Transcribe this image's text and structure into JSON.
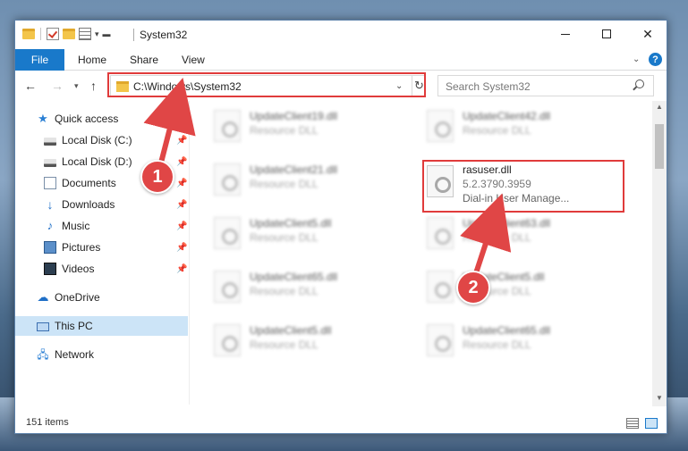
{
  "window": {
    "title": "System32",
    "ribbon_tabs": {
      "file": "File",
      "home": "Home",
      "share": "Share",
      "view": "View"
    },
    "help": "?"
  },
  "navigation": {
    "address": "C:\\Windows\\System32",
    "search_placeholder": "Search System32"
  },
  "sidebar": {
    "items": [
      {
        "label": "Quick access",
        "icon": "star-icon"
      },
      {
        "label": "Local Disk (C:)",
        "icon": "drive-icon",
        "pinned": true
      },
      {
        "label": "Local Disk (D:)",
        "icon": "drive-icon",
        "pinned": true
      },
      {
        "label": "Documents",
        "icon": "documents-icon",
        "pinned": true
      },
      {
        "label": "Downloads",
        "icon": "download-icon",
        "pinned": true
      },
      {
        "label": "Music",
        "icon": "music-icon",
        "pinned": true
      },
      {
        "label": "Pictures",
        "icon": "pictures-icon",
        "pinned": true
      },
      {
        "label": "Videos",
        "icon": "videos-icon",
        "pinned": true
      },
      {
        "label": "OneDrive",
        "icon": "onedrive-icon"
      },
      {
        "label": "This PC",
        "icon": "pc-icon",
        "selected": true
      },
      {
        "label": "Network",
        "icon": "network-icon"
      }
    ]
  },
  "files": [
    {
      "name": "UpdateClient19.dll",
      "type": "Resource DLL"
    },
    {
      "name": "UpdateClient42.dll",
      "type": "Resource DLL"
    },
    {
      "name": "UpdateClient21.dll",
      "type": "Resource DLL"
    },
    {
      "name": "rasuser.dll",
      "type": "5.2.3790.3959",
      "description": "Dial-in User Manage..."
    },
    {
      "name": "UpdateClient5.dll",
      "type": "Resource DLL"
    },
    {
      "name": "UpdateClient63.dll",
      "type": "Resource DLL"
    },
    {
      "name": "UpdateClient65.dll",
      "type": "Resource DLL"
    },
    {
      "name": "UpdateClient5.dll",
      "type": "Resource DLL"
    },
    {
      "name": "UpdateClient5.dll",
      "type": "Resource DLL"
    },
    {
      "name": "UpdateClient65.dll",
      "type": "Resource DLL"
    }
  ],
  "status": {
    "item_count": "151 items"
  },
  "annotations": {
    "step1": "1",
    "step2": "2",
    "color": "#e04646"
  }
}
